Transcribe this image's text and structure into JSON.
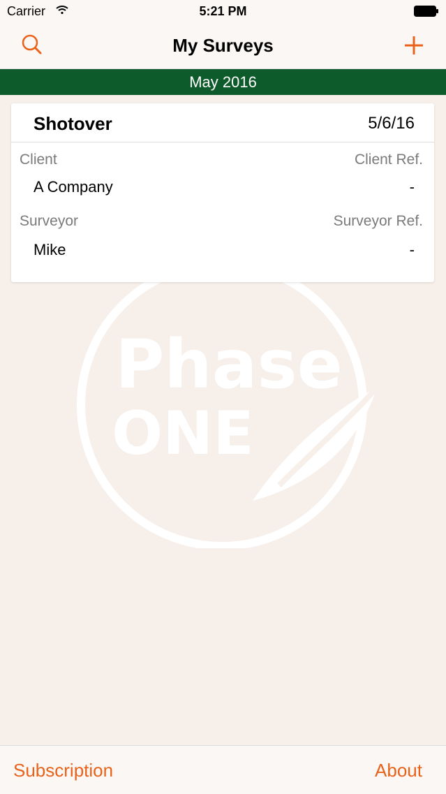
{
  "status_bar": {
    "carrier": "Carrier",
    "time": "5:21 PM"
  },
  "nav": {
    "title": "My Surveys",
    "search_icon": "search-icon",
    "add_icon": "plus-icon",
    "accent_color": "#e8621a"
  },
  "section": {
    "title": "May 2016",
    "color": "#0d5b2b"
  },
  "surveys": [
    {
      "name": "Shotover",
      "date": "5/6/16",
      "client_label": "Client",
      "client": "A Company",
      "client_ref_label": "Client Ref.",
      "client_ref": "-",
      "surveyor_label": "Surveyor",
      "surveyor": "Mike",
      "surveyor_ref_label": "Surveyor Ref.",
      "surveyor_ref": "-"
    }
  ],
  "watermark": {
    "line1": "Phase",
    "line2": "ONE"
  },
  "tabbar": {
    "subscription": "Subscription",
    "about": "About"
  }
}
